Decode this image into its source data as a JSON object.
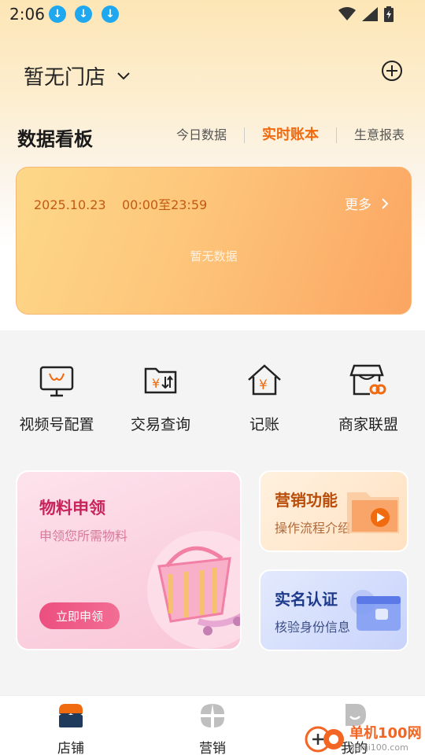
{
  "status_bar": {
    "time": "2:06"
  },
  "header": {
    "store_name": "暂无门店"
  },
  "dashboard": {
    "title": "数据看板",
    "tabs": [
      {
        "label": "今日数据"
      },
      {
        "label": "实时账本"
      },
      {
        "label": "生意报表"
      }
    ],
    "active_tab": "实时账本",
    "card": {
      "date_range": "2025.10.23    00:00至23:59",
      "more_label": "更多",
      "empty_text": "暂无数据"
    }
  },
  "features": [
    {
      "label": "视频号配置",
      "icon": "video-account-icon"
    },
    {
      "label": "交易查询",
      "icon": "transaction-folder-icon"
    },
    {
      "label": "记账",
      "icon": "house-yen-icon"
    },
    {
      "label": "商家联盟",
      "icon": "store-alliance-icon"
    }
  ],
  "promos": {
    "materials": {
      "title": "物料申领",
      "subtitle": "申领您所需物料",
      "button": "立即申领"
    },
    "marketing": {
      "title": "营销功能",
      "subtitle": "操作流程介绍"
    },
    "verify": {
      "title": "实名认证",
      "subtitle": "核验身份信息"
    }
  },
  "bottom_nav": [
    {
      "label": "店铺",
      "icon": "store-icon"
    },
    {
      "label": "营销",
      "icon": "marketing-icon"
    },
    {
      "label": "我的",
      "icon": "profile-icon"
    }
  ],
  "watermark": {
    "text": "单机100网",
    "url": "danji100.com"
  },
  "colors": {
    "accent": "#f06a0f",
    "primary_text": "#222222",
    "status_download": "#1fa7f0"
  }
}
